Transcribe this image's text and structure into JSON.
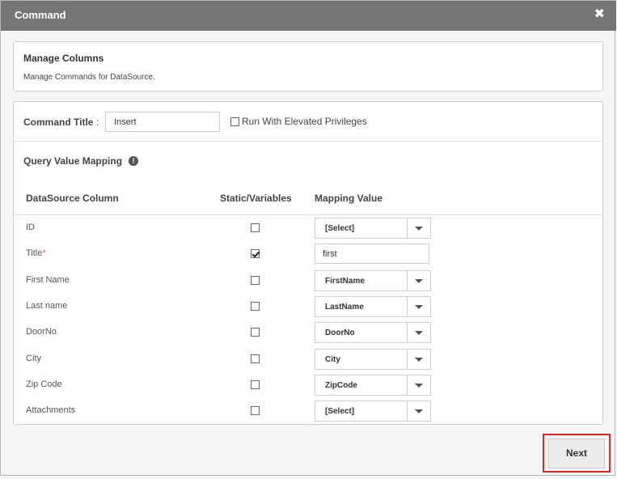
{
  "dialog": {
    "title": "Command",
    "close_glyph": "✖"
  },
  "manage": {
    "title": "Manage Columns",
    "subtitle": "Manage Commands for DataSource."
  },
  "command": {
    "title_label": "Command Title",
    "colon": ":",
    "title_value": "Insert",
    "elevated_label": "Run With Elevated Privileges",
    "elevated_checked": false
  },
  "mapping": {
    "heading": "Query Value Mapping",
    "info_glyph": "!",
    "headers": {
      "column": "DataSource Column",
      "static": "Static/Variables",
      "value": "Mapping Value"
    },
    "rows": [
      {
        "label": "ID",
        "required": "",
        "static": false,
        "value": "[Select]",
        "input_type": "select"
      },
      {
        "label": "Title",
        "required": "*",
        "static": true,
        "value": "first",
        "input_type": "text"
      },
      {
        "label": "First Name",
        "required": "",
        "static": false,
        "value": "FirstName",
        "input_type": "select"
      },
      {
        "label": "Last name",
        "required": "",
        "static": false,
        "value": "LastName",
        "input_type": "select"
      },
      {
        "label": "DoorNo",
        "required": "",
        "static": false,
        "value": "DoorNo",
        "input_type": "select"
      },
      {
        "label": "City",
        "required": "",
        "static": false,
        "value": "City",
        "input_type": "select"
      },
      {
        "label": "Zip Code",
        "required": "",
        "static": false,
        "value": "ZipCode",
        "input_type": "select"
      },
      {
        "label": "Attachments",
        "required": "",
        "static": false,
        "value": "[Select]",
        "input_type": "select"
      }
    ]
  },
  "footer": {
    "next_label": "Next",
    "highlight_color": "#e02424"
  },
  "colors": {
    "titlebar": "#757575",
    "required": "#d9534f"
  }
}
